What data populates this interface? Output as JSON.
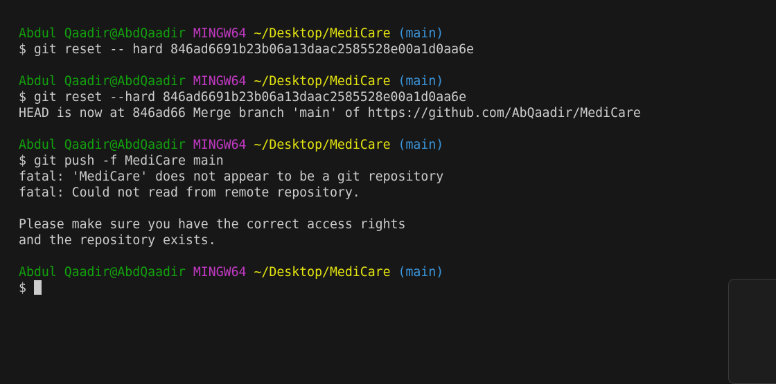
{
  "prompt": {
    "user": "Abdul Qaadir@AbdQaadir",
    "system": "MINGW64",
    "path": "~/Desktop/MediCare",
    "branch": "(main)",
    "symbol": "$"
  },
  "blocks": [
    {
      "command": "git reset -- hard 846ad6691b23b06a13daac2585528e00a1d0aa6e",
      "output": []
    },
    {
      "command": "git reset --hard 846ad6691b23b06a13daac2585528e00a1d0aa6e",
      "output": [
        "HEAD is now at 846ad66 Merge branch 'main' of https://github.com/AbQaadir/MediCare"
      ]
    },
    {
      "command": "git push -f MediCare main",
      "output": [
        "fatal: 'MediCare' does not appear to be a git repository",
        "fatal: Could not read from remote repository.",
        "",
        "Please make sure you have the correct access rights",
        "and the repository exists."
      ]
    }
  ],
  "colors": {
    "user": "#13a10e",
    "system": "#c239c4",
    "path": "#e5e510",
    "branch": "#3a96dd",
    "text": "#cccccc",
    "background": "#171717"
  }
}
